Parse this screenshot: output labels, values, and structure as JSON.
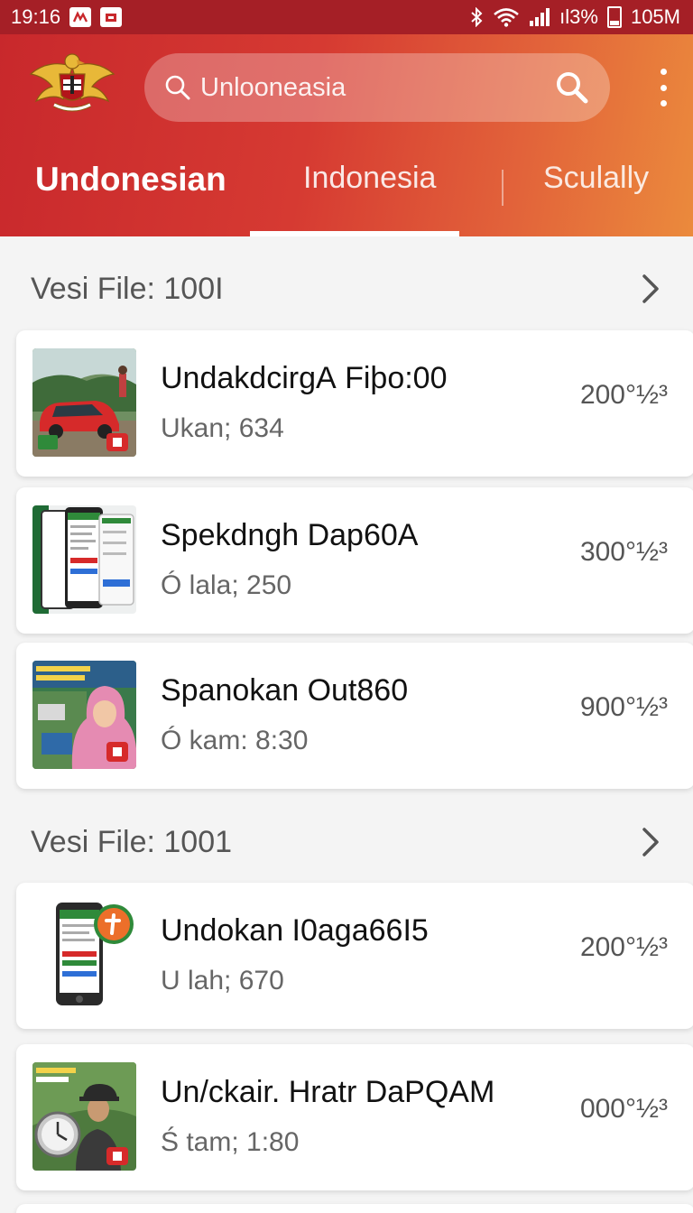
{
  "status_bar": {
    "time": "19:16",
    "battery_text": "ıl3%",
    "data_text": "105M"
  },
  "search": {
    "placeholder": "Unlooneasia"
  },
  "tabs": [
    {
      "label": "Undonesian",
      "active": true
    },
    {
      "label": "Indonesia",
      "active": false
    },
    {
      "label": "Sculally",
      "active": false
    }
  ],
  "sections": [
    {
      "title": "Vesi File: 100I",
      "items": [
        {
          "title": "UndakdcirgА Fiþo:00",
          "subtitle": "Ukan; 634",
          "value": "200°½³"
        },
        {
          "title": "Spekdngh Dap60A",
          "subtitle": "Ó lala; 250",
          "value": "300°½³"
        },
        {
          "title": "Spanokan Out860",
          "subtitle": "Ó kam: 8:30",
          "value": "900°½³"
        }
      ]
    },
    {
      "title": "Vesi File: 1001",
      "items": [
        {
          "title": "Undokan I0aɡa66I5",
          "subtitle": "U lah; 670",
          "value": "200°½³"
        },
        {
          "title": "Un/ckair. Hratr DaPQAM",
          "subtitle": "Ś tam; 1:80",
          "value": "000°½³"
        }
      ]
    }
  ],
  "colors": {
    "header_start": "#c8282c",
    "header_end": "#eb8a3c",
    "status_bar": "#a51f26",
    "card_bg": "#ffffff",
    "page_bg": "#f4f4f4"
  },
  "icons": {
    "search_left": "search-icon",
    "search_button": "search-icon",
    "menu": "more-vertical-icon",
    "section_chevron": "chevron-right-icon",
    "logo": "garuda-emblem-logo"
  }
}
